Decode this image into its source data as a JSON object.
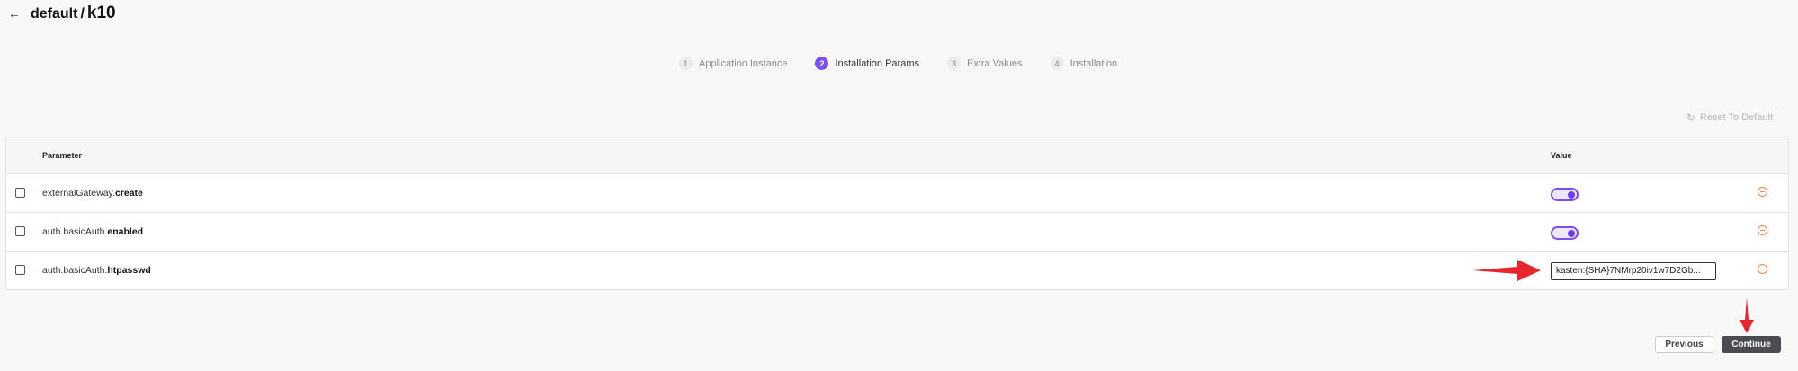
{
  "header": {
    "back_icon": "arrow-left-icon",
    "namespace": "default",
    "separator": "/",
    "app_name": "k10"
  },
  "stepper": {
    "steps": [
      {
        "num": "1",
        "label": "Application Instance"
      },
      {
        "num": "2",
        "label": "Installation Params"
      },
      {
        "num": "3",
        "label": "Extra Values"
      },
      {
        "num": "4",
        "label": "Installation"
      }
    ],
    "active_step": 2,
    "accent_color": "#7b4ff5"
  },
  "reset": {
    "icon": "reset-icon",
    "label": "Reset To Default"
  },
  "table": {
    "columns": {
      "parameter": "Parameter",
      "value": "Value"
    },
    "rows": [
      {
        "prefix": "externalGateway.",
        "key": "create",
        "type": "toggle",
        "value": true
      },
      {
        "prefix": "auth.basicAuth.",
        "key": "enabled",
        "type": "toggle",
        "value": true
      },
      {
        "prefix": "auth.basicAuth.",
        "key": "htpasswd",
        "type": "text",
        "value": "kasten:{SHA}7NMrp20iv1w7D2Gb..."
      }
    ]
  },
  "actions": {
    "previous_label": "Previous",
    "continue_label": "Continue"
  },
  "annotation_color": "#e8242c"
}
